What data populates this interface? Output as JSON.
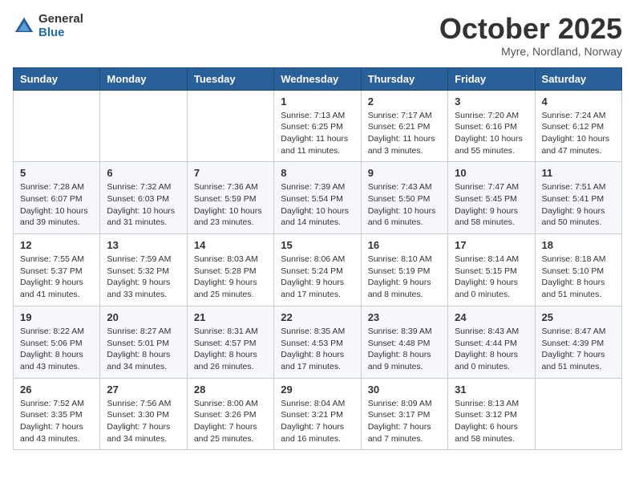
{
  "header": {
    "logo_general": "General",
    "logo_blue": "Blue",
    "month": "October 2025",
    "location": "Myre, Nordland, Norway"
  },
  "days_of_week": [
    "Sunday",
    "Monday",
    "Tuesday",
    "Wednesday",
    "Thursday",
    "Friday",
    "Saturday"
  ],
  "weeks": [
    [
      {
        "day": "",
        "info": ""
      },
      {
        "day": "",
        "info": ""
      },
      {
        "day": "",
        "info": ""
      },
      {
        "day": "1",
        "info": "Sunrise: 7:13 AM\nSunset: 6:25 PM\nDaylight: 11 hours\nand 11 minutes."
      },
      {
        "day": "2",
        "info": "Sunrise: 7:17 AM\nSunset: 6:21 PM\nDaylight: 11 hours\nand 3 minutes."
      },
      {
        "day": "3",
        "info": "Sunrise: 7:20 AM\nSunset: 6:16 PM\nDaylight: 10 hours\nand 55 minutes."
      },
      {
        "day": "4",
        "info": "Sunrise: 7:24 AM\nSunset: 6:12 PM\nDaylight: 10 hours\nand 47 minutes."
      }
    ],
    [
      {
        "day": "5",
        "info": "Sunrise: 7:28 AM\nSunset: 6:07 PM\nDaylight: 10 hours\nand 39 minutes."
      },
      {
        "day": "6",
        "info": "Sunrise: 7:32 AM\nSunset: 6:03 PM\nDaylight: 10 hours\nand 31 minutes."
      },
      {
        "day": "7",
        "info": "Sunrise: 7:36 AM\nSunset: 5:59 PM\nDaylight: 10 hours\nand 23 minutes."
      },
      {
        "day": "8",
        "info": "Sunrise: 7:39 AM\nSunset: 5:54 PM\nDaylight: 10 hours\nand 14 minutes."
      },
      {
        "day": "9",
        "info": "Sunrise: 7:43 AM\nSunset: 5:50 PM\nDaylight: 10 hours\nand 6 minutes."
      },
      {
        "day": "10",
        "info": "Sunrise: 7:47 AM\nSunset: 5:45 PM\nDaylight: 9 hours\nand 58 minutes."
      },
      {
        "day": "11",
        "info": "Sunrise: 7:51 AM\nSunset: 5:41 PM\nDaylight: 9 hours\nand 50 minutes."
      }
    ],
    [
      {
        "day": "12",
        "info": "Sunrise: 7:55 AM\nSunset: 5:37 PM\nDaylight: 9 hours\nand 41 minutes."
      },
      {
        "day": "13",
        "info": "Sunrise: 7:59 AM\nSunset: 5:32 PM\nDaylight: 9 hours\nand 33 minutes."
      },
      {
        "day": "14",
        "info": "Sunrise: 8:03 AM\nSunset: 5:28 PM\nDaylight: 9 hours\nand 25 minutes."
      },
      {
        "day": "15",
        "info": "Sunrise: 8:06 AM\nSunset: 5:24 PM\nDaylight: 9 hours\nand 17 minutes."
      },
      {
        "day": "16",
        "info": "Sunrise: 8:10 AM\nSunset: 5:19 PM\nDaylight: 9 hours\nand 8 minutes."
      },
      {
        "day": "17",
        "info": "Sunrise: 8:14 AM\nSunset: 5:15 PM\nDaylight: 9 hours\nand 0 minutes."
      },
      {
        "day": "18",
        "info": "Sunrise: 8:18 AM\nSunset: 5:10 PM\nDaylight: 8 hours\nand 51 minutes."
      }
    ],
    [
      {
        "day": "19",
        "info": "Sunrise: 8:22 AM\nSunset: 5:06 PM\nDaylight: 8 hours\nand 43 minutes."
      },
      {
        "day": "20",
        "info": "Sunrise: 8:27 AM\nSunset: 5:01 PM\nDaylight: 8 hours\nand 34 minutes."
      },
      {
        "day": "21",
        "info": "Sunrise: 8:31 AM\nSunset: 4:57 PM\nDaylight: 8 hours\nand 26 minutes."
      },
      {
        "day": "22",
        "info": "Sunrise: 8:35 AM\nSunset: 4:53 PM\nDaylight: 8 hours\nand 17 minutes."
      },
      {
        "day": "23",
        "info": "Sunrise: 8:39 AM\nSunset: 4:48 PM\nDaylight: 8 hours\nand 9 minutes."
      },
      {
        "day": "24",
        "info": "Sunrise: 8:43 AM\nSunset: 4:44 PM\nDaylight: 8 hours\nand 0 minutes."
      },
      {
        "day": "25",
        "info": "Sunrise: 8:47 AM\nSunset: 4:39 PM\nDaylight: 7 hours\nand 51 minutes."
      }
    ],
    [
      {
        "day": "26",
        "info": "Sunrise: 7:52 AM\nSunset: 3:35 PM\nDaylight: 7 hours\nand 43 minutes."
      },
      {
        "day": "27",
        "info": "Sunrise: 7:56 AM\nSunset: 3:30 PM\nDaylight: 7 hours\nand 34 minutes."
      },
      {
        "day": "28",
        "info": "Sunrise: 8:00 AM\nSunset: 3:26 PM\nDaylight: 7 hours\nand 25 minutes."
      },
      {
        "day": "29",
        "info": "Sunrise: 8:04 AM\nSunset: 3:21 PM\nDaylight: 7 hours\nand 16 minutes."
      },
      {
        "day": "30",
        "info": "Sunrise: 8:09 AM\nSunset: 3:17 PM\nDaylight: 7 hours\nand 7 minutes."
      },
      {
        "day": "31",
        "info": "Sunrise: 8:13 AM\nSunset: 3:12 PM\nDaylight: 6 hours\nand 58 minutes."
      },
      {
        "day": "",
        "info": ""
      }
    ]
  ]
}
